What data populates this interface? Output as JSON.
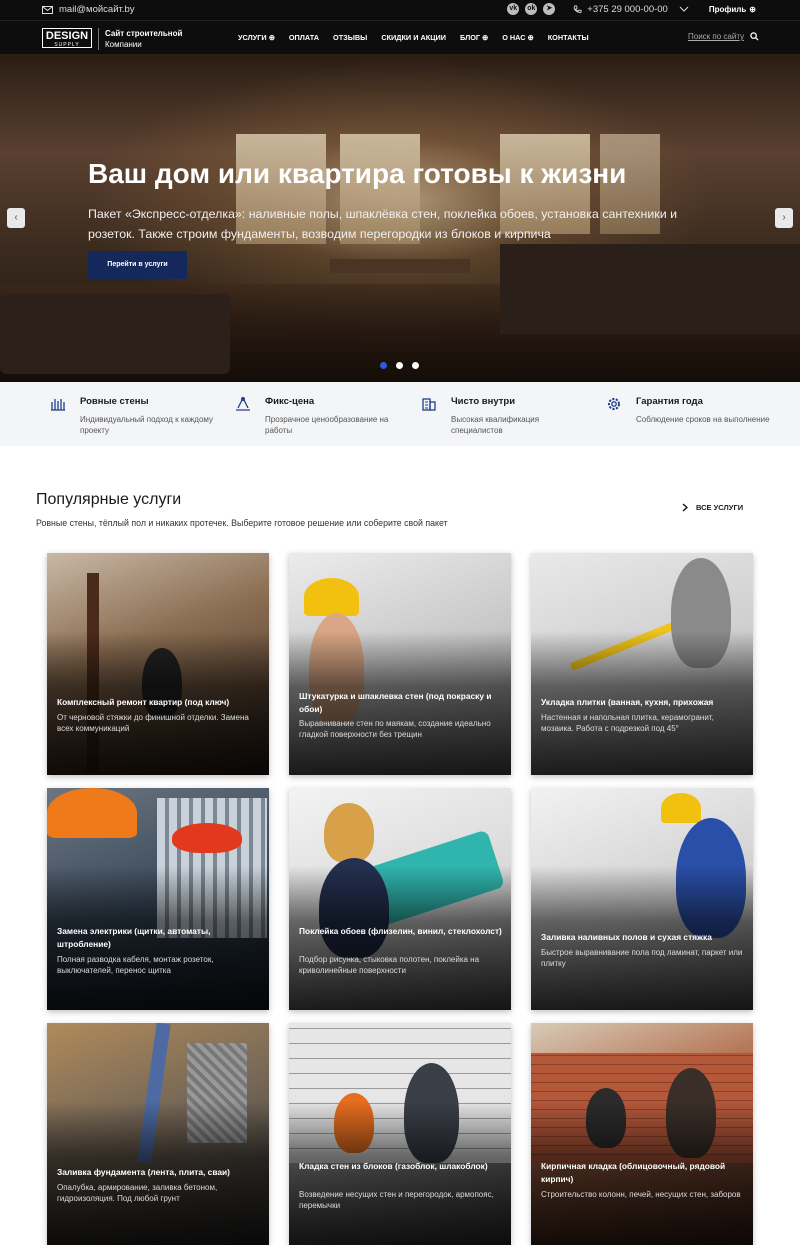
{
  "topbar": {
    "email": "mail@мойсайт.by",
    "phone": "+375 29 000-00-00",
    "profile": "Профиль",
    "socials": [
      "vk-icon",
      "ok-icon",
      "telegram-icon"
    ]
  },
  "nav": {
    "logo_main": "DESIGN",
    "logo_sub": "SUPPLY",
    "brand_line1": "Сайт строительной",
    "brand_line2": "Компании",
    "menu": [
      "УСЛУГИ",
      "ОПЛАТА",
      "ОТЗЫВЫ",
      "СКИДКИ И АКЦИИ",
      "БЛОГ",
      "О НАС",
      "КОНТАКТЫ"
    ],
    "search_placeholder": "Поиск по сайту"
  },
  "hero": {
    "title": "Ваш дом или квартира готовы к жизни",
    "text": "Пакет «Экспресс-отделка»: наливные полы, шпаклёвка стен, поклейка обоев, установка сантехники и розеток. Также строим фундаменты, возводим перегородки из блоков и кирпича",
    "button": "Перейти в услуги",
    "active_slide": 1,
    "slides": 3
  },
  "features": [
    {
      "title": "Ровные стены",
      "desc": "Индивидуальный подход к каждому проекту",
      "icon": "wall-icon"
    },
    {
      "title": "Фикс-цена",
      "desc": "Прозрачное ценообразование на работы",
      "icon": "measure-icon"
    },
    {
      "title": "Чисто внутри",
      "desc": "Высокая квалификация специалистов",
      "icon": "building-icon"
    },
    {
      "title": "Гарантия года",
      "desc": "Соблюдение сроков на выполнение",
      "icon": "gear-icon"
    }
  ],
  "services": {
    "title": "Популярные услуги",
    "subtitle": "Ровные стены, тёплый пол и никаких протечек. Выберите готовое решение или соберите свой пакет",
    "all_label": "ВСЕ УСЛУГИ",
    "cards": [
      {
        "title": "Комплексный ремонт квартир (под ключ)",
        "desc": "От черновой стяжки до финишной отделки. Замена всех коммуникаций"
      },
      {
        "title": "Штукатурка и шпаклевка стен (под покраску и обои)",
        "desc": "Выравнивание стен по маякам, создание идеально гладкой поверхности без трещин"
      },
      {
        "title": "Укладка плитки (ванная, кухня, прихожая",
        "desc": "Настенная и напольная плитка, керамогранит, мозаика. Работа с подрезкой под 45°"
      },
      {
        "title": "Замена электрики (щитки, автоматы, штробление)",
        "desc": "Полная разводка кабеля, монтаж розеток, выключателей, перенос щитка"
      },
      {
        "title": "Поклейка обоев (флизелин, винил, стеклохолст)",
        "desc": "Подбор рисунка, стыковка полотен, поклейка на криволинейные поверхности"
      },
      {
        "title": "Заливка наливных полов и сухая стяжка",
        "desc": "Быстрое выравнивание пола под ламинат, паркет или плитку"
      },
      {
        "title": "Заливка фундамента (лента, плита, сваи)",
        "desc": "Опалубка, армирование, заливка бетоном, гидроизоляция. Под любой грунт"
      },
      {
        "title": "Кладка стен из блоков (газоблок, шлакоблок)",
        "desc": "Возведение несущих стен и перегородок, армопояс, перемычки"
      },
      {
        "title": "Кирпичная кладка (облицовочный, рядовой кирпич)",
        "desc": "Строительство колонн, печей, несущих стен, заборов"
      }
    ]
  }
}
